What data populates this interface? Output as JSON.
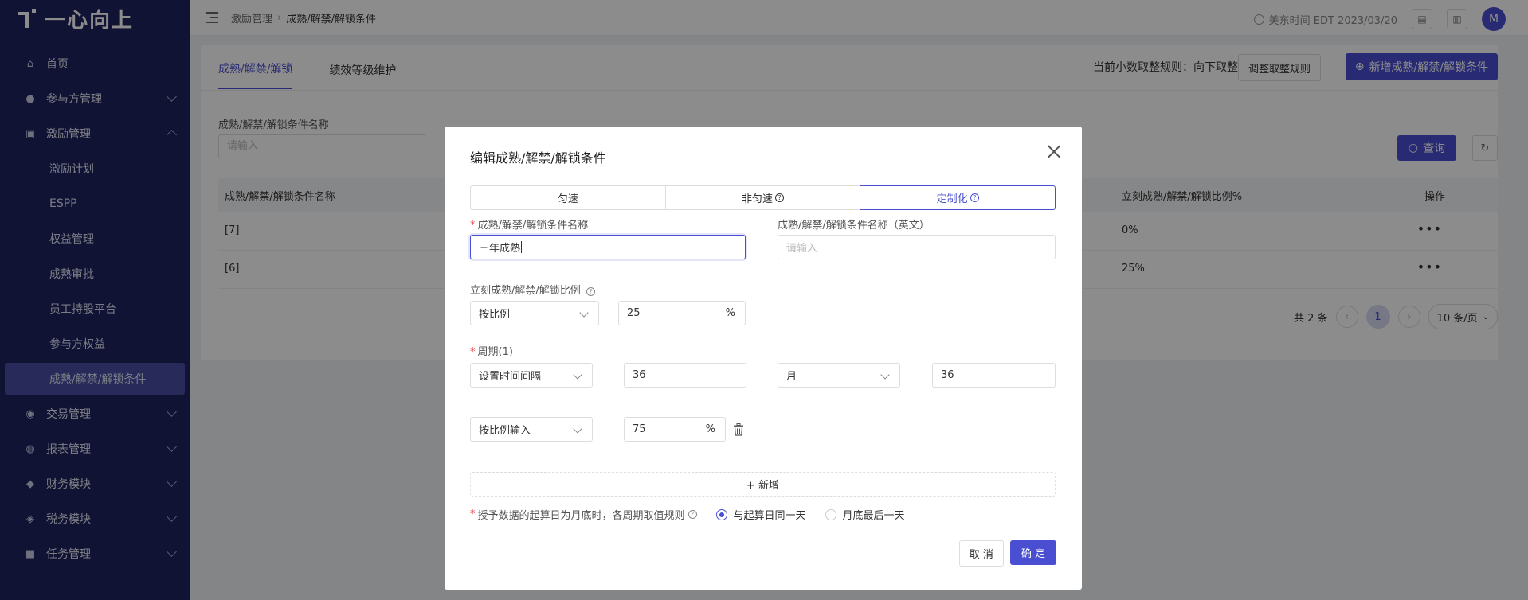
{
  "colors": {
    "accent": "#4a4fd1",
    "sidebar_bg": "#1f2462",
    "required": "#e84b4b"
  },
  "brand": {
    "name": "一心向上"
  },
  "sidebar": {
    "items": [
      {
        "label": "首页",
        "icon": "home-icon",
        "expandable": false
      },
      {
        "label": "参与方管理",
        "icon": "people-icon",
        "expandable": true
      },
      {
        "label": "激励管理",
        "icon": "gift-icon",
        "expandable": true,
        "expanded": true,
        "children": [
          {
            "label": "激励计划"
          },
          {
            "label": "ESPP"
          },
          {
            "label": "权益管理"
          },
          {
            "label": "成熟审批"
          },
          {
            "label": "员工持股平台"
          },
          {
            "label": "参与方权益"
          },
          {
            "label": "成熟/解禁/解锁条件",
            "active": true
          }
        ]
      },
      {
        "label": "交易管理",
        "icon": "trade-icon",
        "expandable": true
      },
      {
        "label": "报表管理",
        "icon": "report-icon",
        "expandable": true
      },
      {
        "label": "财务模块",
        "icon": "finance-icon",
        "expandable": true
      },
      {
        "label": "税务模块",
        "icon": "tax-icon",
        "expandable": true
      },
      {
        "label": "任务管理",
        "icon": "task-icon",
        "expandable": true
      }
    ]
  },
  "topbar": {
    "breadcrumb": [
      "激励管理",
      "成熟/解禁/解锁条件"
    ],
    "time": "美东时间 EDT 2023/03/20",
    "avatar": "M"
  },
  "main": {
    "tabs": [
      {
        "label": "成熟/解禁/解锁",
        "active": true
      },
      {
        "label": "绩效等级维护"
      }
    ],
    "rounding_rule": "当前小数取整规则：向下取整",
    "adjust_button": "调整取整规则",
    "new_button": "新增成熟/解禁/解锁条件",
    "filter": {
      "label": "成熟/解禁/解锁条件名称",
      "placeholder": "请输入"
    },
    "query_button": "查询",
    "table": {
      "columns": [
        "成熟/解禁/解锁条件名称",
        "立刻成熟/解禁/解锁比例%",
        "操作"
      ],
      "rows": [
        {
          "name": "[7]",
          "ratio": "0%"
        },
        {
          "name": "[6]",
          "ratio": "25%"
        }
      ]
    },
    "pager": {
      "total": "共 2 条",
      "current": "1",
      "page_size": "10 条/页"
    }
  },
  "modal": {
    "title": "编辑成熟/解禁/解锁条件",
    "segments": [
      "匀速",
      "非匀速",
      "定制化"
    ],
    "active_segment": "定制化",
    "name_label": "成熟/解禁/解锁条件名称",
    "name_value": "三年成熟",
    "name_en_label": "成熟/解禁/解锁条件名称（英文）",
    "name_en_placeholder": "请输入",
    "immediate_label": "立刻成熟/解禁/解锁比例",
    "immediate_mode": "按比例",
    "immediate_value": "25",
    "percent": "%",
    "period_label": "周期(1)",
    "period_mode": "设置时间间隔",
    "period_interval": "36",
    "period_unit": "月",
    "period_count": "36",
    "ratio_mode": "按比例输入",
    "ratio_value": "75",
    "add_label": "+ 新增",
    "rule_label": "授予数据的起算日为月底时，各周期取值规则",
    "rule_options": [
      "与起算日同一天",
      "月底最后一天"
    ],
    "rule_selected": "与起算日同一天",
    "cancel": "取 消",
    "ok": "确 定"
  }
}
